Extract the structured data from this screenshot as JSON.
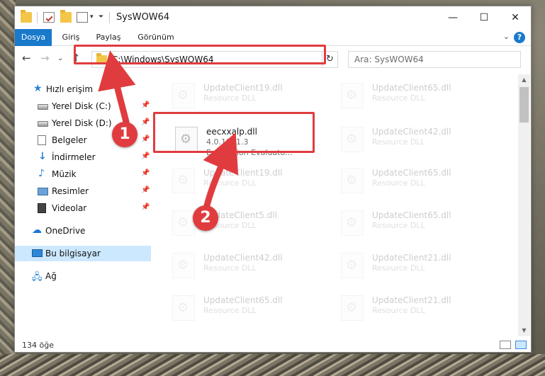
{
  "window": {
    "title": "SysWOW64",
    "minimize": "—",
    "maximize": "☐",
    "close": "✕"
  },
  "ribbon": {
    "tabs": [
      "Dosya",
      "Giriş",
      "Paylaş",
      "Görünüm"
    ],
    "active_tab": "Dosya",
    "help": "?",
    "collapse": "⌄"
  },
  "address": {
    "path": "C:\\Windows\\SysWOW64",
    "refresh": "↻"
  },
  "search": {
    "placeholder": "Ara: SysWOW64"
  },
  "nav_buttons": {
    "back": "←",
    "forward": "→",
    "recent": "⌄",
    "up": "↑"
  },
  "sidebar": {
    "items": [
      {
        "label": "Hızlı erişim"
      },
      {
        "label": "Yerel Disk (C:)"
      },
      {
        "label": "Yerel Disk (D:)"
      },
      {
        "label": "Belgeler"
      },
      {
        "label": "İndirmeler"
      },
      {
        "label": "Müzik"
      },
      {
        "label": "Resimler"
      },
      {
        "label": "Videolar"
      },
      {
        "label": "OneDrive"
      },
      {
        "label": "Bu bilgisayar"
      },
      {
        "label": "Ağ"
      }
    ]
  },
  "files": [
    {
      "name": "UpdateClient19.dll",
      "type": "Resource DLL"
    },
    {
      "name": "UpdateClient65.dll",
      "type": "Resource DLL"
    },
    {
      "name": "eecxxalp.dll",
      "version": "4.0.1381.3",
      "description": "Expression Evaluato..."
    },
    {
      "name": "UpdateClient42.dll",
      "type": "Resource DLL"
    },
    {
      "name": "UpdateClient19.dll",
      "type": "Resource DLL"
    },
    {
      "name": "UpdateClient65.dll",
      "type": "Resource DLL"
    },
    {
      "name": "UpdateClient5.dll",
      "type": "Resource DLL"
    },
    {
      "name": "UpdateClient65.dll",
      "type": "Resource DLL"
    },
    {
      "name": "UpdateClient42.dll",
      "type": "Resource DLL"
    },
    {
      "name": "UpdateClient21.dll",
      "type": "Resource DLL"
    },
    {
      "name": "UpdateClient65.dll",
      "type": "Resource DLL"
    },
    {
      "name": "UpdateClient21.dll",
      "type": "Resource DLL"
    }
  ],
  "status": {
    "count": "134 öğe"
  },
  "annotations": {
    "step1": "1",
    "step2": "2"
  },
  "colors": {
    "accent": "#1979ca",
    "highlight": "#e03c3f",
    "selected": "#cce8ff"
  },
  "icons": [
    "folder-icon",
    "properties-icon",
    "new-folder-icon",
    "chevron-down-icon",
    "search-icon",
    "refresh-icon",
    "pin-icon",
    "star-icon",
    "drive-icon",
    "document-icon",
    "download-icon",
    "music-icon",
    "pictures-icon",
    "video-icon",
    "cloud-icon",
    "computer-icon",
    "network-icon",
    "dll-file-icon"
  ]
}
